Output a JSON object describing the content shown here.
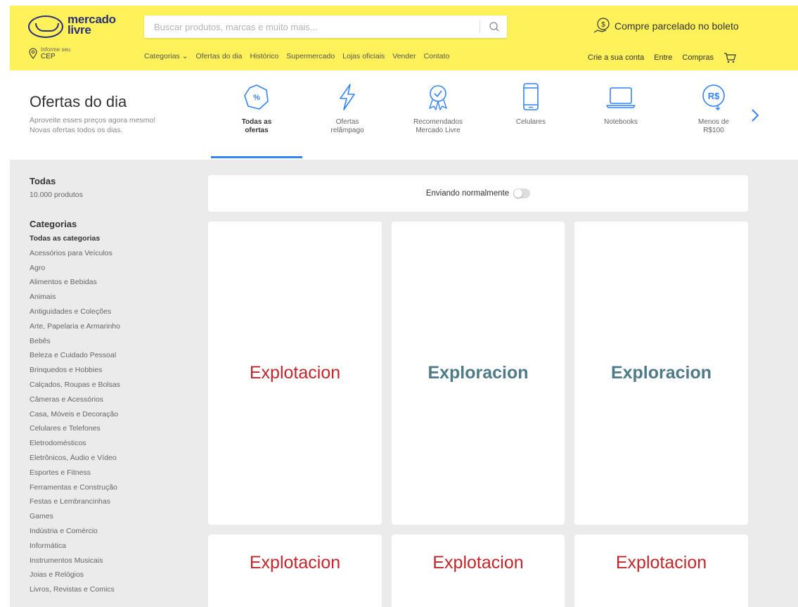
{
  "header": {
    "logo": {
      "line1": "mercado",
      "line2": "livre"
    },
    "search_placeholder": "Buscar produtos, marcas e muito mais...",
    "promo": "Compre parcelado no boleto",
    "cep": {
      "small": "Informe seu",
      "label": "CEP"
    },
    "nav": [
      "Categorias ⌄",
      "Ofertas do dia",
      "Histórico",
      "Supermercado",
      "Lojas oficiais",
      "Vender",
      "Contato"
    ],
    "account": {
      "create": "Crie a sua conta",
      "login": "Entre",
      "purchases": "Compras"
    },
    "colors": {
      "yellow": "#fff159",
      "navy": "#2d3277"
    }
  },
  "deals": {
    "title": "Ofertas do dia",
    "subtitle_line1": "Aproveite esses preços agora mesmo!",
    "subtitle_line2": "Novas ofertas todos os dias.",
    "categories": [
      {
        "line1": "Todas as",
        "line2": "ofertas",
        "icon": "percent-badge-icon",
        "active": true
      },
      {
        "line1": "Ofertas",
        "line2": "relâmpago",
        "icon": "lightning-icon",
        "active": false
      },
      {
        "line1": "Recomendados",
        "line2": "Mercado Livre",
        "icon": "award-icon",
        "active": false
      },
      {
        "line1": "Celulares",
        "line2": "",
        "icon": "phone-icon",
        "active": false
      },
      {
        "line1": "Notebooks",
        "line2": "",
        "icon": "laptop-icon",
        "active": false
      },
      {
        "line1": "Menos de",
        "line2": "R$100",
        "icon": "money-icon",
        "active": false
      }
    ],
    "accent": "#3483fa"
  },
  "sidebar": {
    "title": "Todas",
    "count": "10.000 produtos",
    "categories_title": "Categorias",
    "categories": [
      "Todas as categorias",
      "Acessórios para Veículos",
      "Agro",
      "Alimentos e Bebidas",
      "Animais",
      "Antiguidades e Coleções",
      "Arte, Papelaria e Armarinho",
      "Bebês",
      "Beleza e Cuidado Pessoal",
      "Brinquedos e Hobbies",
      "Calçados, Roupas e Bolsas",
      "Câmeras e Acessórios",
      "Casa, Móveis e Decoração",
      "Celulares e Telefones",
      "Eletrodomésticos",
      "Eletrônicos, Áudio e Vídeo",
      "Esportes e Fitness",
      "Ferramentas e Construção",
      "Festas e Lembrancinhas",
      "Games",
      "Indústria e Comércio",
      "Informática",
      "Instrumentos Musicais",
      "Joias e Relógios",
      "Livros, Revistas e Comics"
    ]
  },
  "main": {
    "shipping_label": "Enviando normalmente",
    "cards": [
      "Explotacion",
      "Exploracion",
      "Exploracion",
      "Explotacion",
      "Explotacion",
      "Explotacion"
    ],
    "colors": {
      "explotacion": "#c0272d",
      "exploracion": "#4f7a87"
    }
  }
}
